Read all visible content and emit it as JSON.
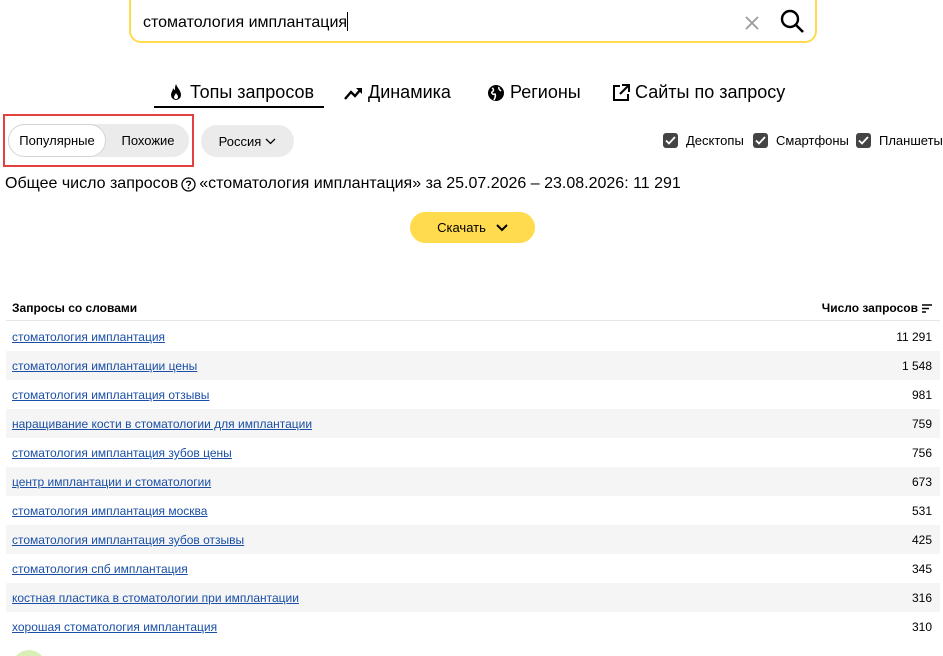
{
  "search": {
    "query": "стоматология имплантация"
  },
  "tabs": [
    {
      "label": "Топы запросов",
      "icon": "flame-icon",
      "active": true
    },
    {
      "label": "Динамика",
      "icon": "trend-icon",
      "active": false
    },
    {
      "label": "Регионы",
      "icon": "globe-icon",
      "active": false
    },
    {
      "label": "Сайты по запросу",
      "icon": "external-link-icon",
      "active": false
    }
  ],
  "filters": {
    "mode_options": [
      {
        "label": "Популярные",
        "selected": true
      },
      {
        "label": "Похожие",
        "selected": false
      }
    ],
    "region_label": "Россия",
    "devices": [
      {
        "label": "Десктопы",
        "checked": true
      },
      {
        "label": "Смартфоны",
        "checked": true
      },
      {
        "label": "Планшеты",
        "checked": true
      }
    ]
  },
  "summary": {
    "prefix": "Общее число запросов",
    "rest": "«стоматология имплантация» за 25.07.2026 – 23.08.2026: 11 291"
  },
  "download": {
    "label": "Скачать"
  },
  "table": {
    "col_query": "Запросы со словами",
    "col_count": "Число запросов",
    "rows": [
      {
        "query": "стоматология имплантация",
        "count": "11 291"
      },
      {
        "query": "стоматология имплантации цены",
        "count": "1 548"
      },
      {
        "query": "стоматология имплантация отзывы",
        "count": "981"
      },
      {
        "query": "наращивание кости в стоматологии для имплантации",
        "count": "759"
      },
      {
        "query": "стоматология имплантация зубов цены",
        "count": "756"
      },
      {
        "query": "центр имплантации и стоматологии",
        "count": "673"
      },
      {
        "query": "стоматология имплантация москва",
        "count": "531"
      },
      {
        "query": "стоматология имплантация зубов отзывы",
        "count": "425"
      },
      {
        "query": "стоматология спб имплантация",
        "count": "345"
      },
      {
        "query": "костная пластика в стоматологии при имплантации",
        "count": "316"
      },
      {
        "query": "хорошая стоматология имплантация",
        "count": "310"
      }
    ]
  },
  "colors": {
    "accent": "#ffdb4d",
    "link": "#1a4fa5",
    "highlight_border": "#e34040"
  }
}
